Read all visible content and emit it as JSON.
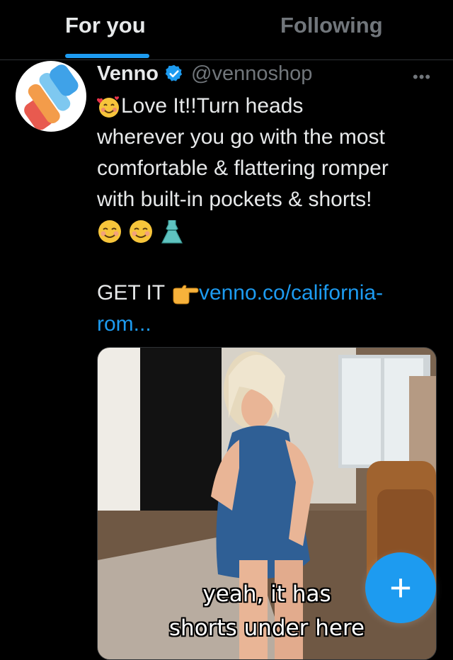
{
  "tabs": {
    "for_you": "For you",
    "following": "Following",
    "active": "For you"
  },
  "post": {
    "display_name": "Venno",
    "handle": "@vennoshop",
    "more": "•••",
    "lines": [
      "Love It!!Turn heads",
      "wherever you go with the most",
      "comfortable & flattering romper",
      "with built-in pockets & shorts!"
    ],
    "get_it": "GET IT",
    "link_part1": "venno.co/california-",
    "link_part2": "rom..."
  },
  "media": {
    "caption_line1": "yeah, it has",
    "caption_line2": "shorts under here"
  },
  "fab": {
    "label": "+"
  },
  "colors": {
    "accent": "#1d9bf0",
    "background": "#000000",
    "text": "#e7e9ea",
    "muted": "#71767b"
  },
  "icons": [
    "venno-logo-icon",
    "verified-badge-icon",
    "more-options-icon",
    "smiling-face-with-hearts-emoji",
    "smiling-face-emoji",
    "dress-emoji",
    "pointing-right-emoji",
    "compose-plus-icon"
  ]
}
